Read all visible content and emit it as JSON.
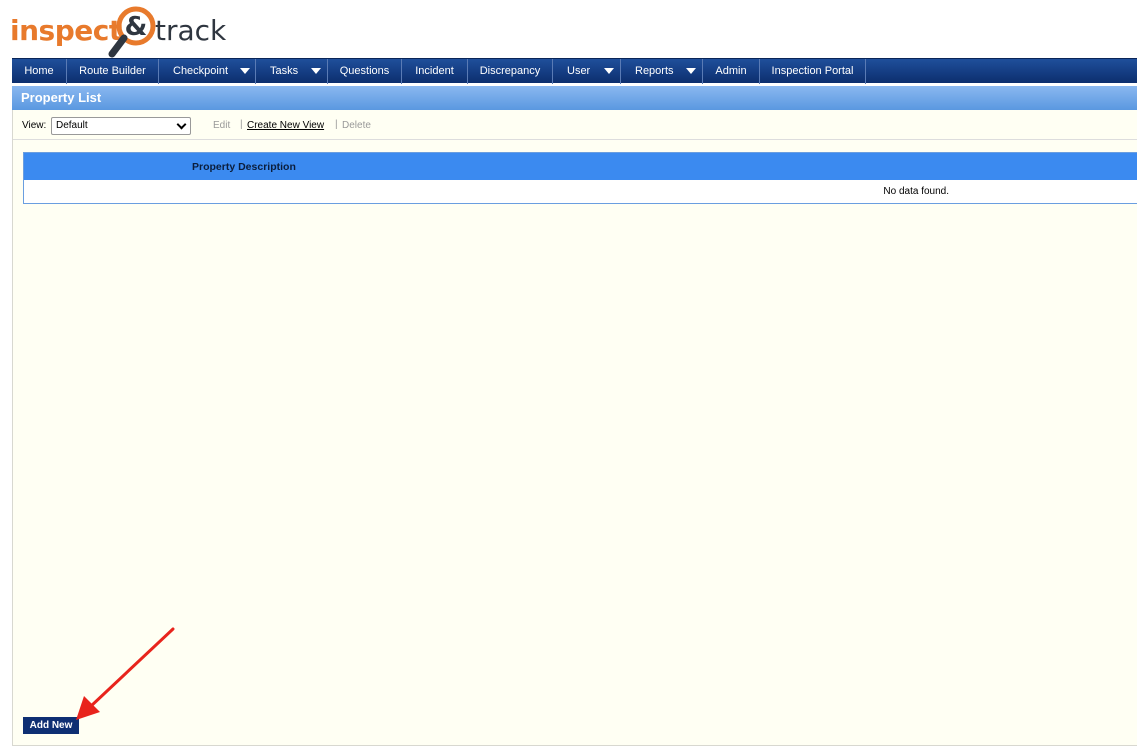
{
  "logo": {
    "word1": "inspect",
    "ampersand": "&",
    "word2": "track"
  },
  "nav": [
    {
      "label": "Home",
      "dropdown": false
    },
    {
      "label": "Route Builder",
      "dropdown": false
    },
    {
      "label": "Checkpoint",
      "dropdown": true
    },
    {
      "label": "Tasks",
      "dropdown": true
    },
    {
      "label": "Questions",
      "dropdown": false
    },
    {
      "label": "Incident",
      "dropdown": false
    },
    {
      "label": "Discrepancy",
      "dropdown": false
    },
    {
      "label": "User",
      "dropdown": true
    },
    {
      "label": "Reports",
      "dropdown": true
    },
    {
      "label": "Admin",
      "dropdown": false
    },
    {
      "label": "Inspection Portal",
      "dropdown": false
    }
  ],
  "page": {
    "title": "Property List"
  },
  "toolbar": {
    "view_label": "View:",
    "view_value": "Default",
    "edit": "Edit",
    "create": "Create New View",
    "delete": "Delete",
    "separator": "|"
  },
  "grid": {
    "columns": [
      "Property Description"
    ],
    "empty_message": "No data found."
  },
  "actions": {
    "add_new": "Add New"
  },
  "colors": {
    "nav": "#0c2e6e",
    "title": "#5a98e0",
    "grid_header": "#3b8af0",
    "accent": "#e87a2c",
    "arrow": "#e8241c"
  }
}
